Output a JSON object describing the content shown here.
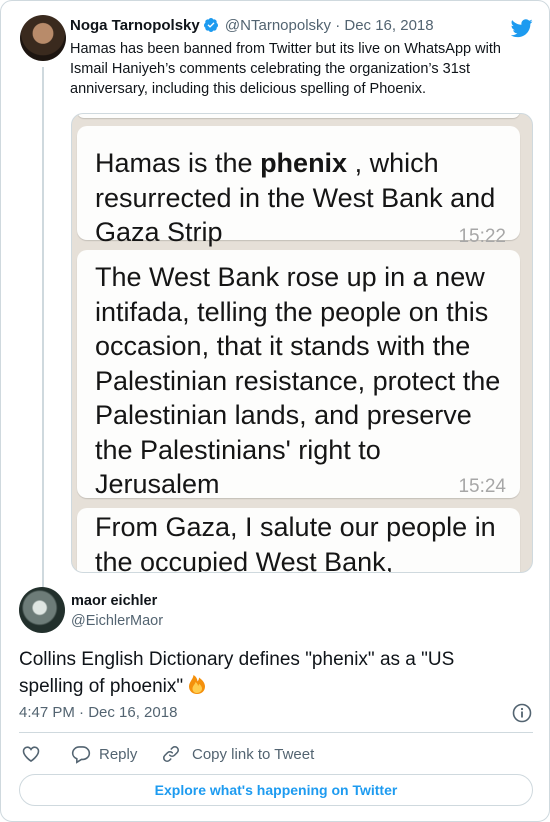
{
  "parent_tweet": {
    "name": "Noga Tarnopolsky",
    "handle": "@NTarnopolsky",
    "date": "Dec 16, 2018",
    "text": "Hamas has been banned from Twitter but its live on WhatsApp with Ismail Haniyeh’s comments celebrating the organization’s 31st anniversary, including this delicious spelling of Phoenix.",
    "media": {
      "bubbles": [
        {
          "before": "Hamas is the ",
          "bold": "phenix",
          "after": " , which resurrected in the West Bank and Gaza Strip",
          "time": "15:22"
        },
        {
          "text": "The West Bank rose up in a new intifada, telling the people on this occasion, that it stands with the Palestinian resistance, protect the Palestinian lands, and preserve the Palestinians' right to Jerusalem",
          "time": "15:24"
        },
        {
          "text": "From Gaza, I salute our people in the occupied West Bank, Jerusalem"
        }
      ]
    }
  },
  "reply_tweet": {
    "name": "maor eichler",
    "handle": "@EichlerMaor",
    "text": "Collins English Dictionary defines \"phenix\" as a \"US spelling of phoenix\"",
    "timestamp": "4:47 PM · Dec 16, 2018"
  },
  "actions": {
    "reply_label": "Reply",
    "copy_label": "Copy link to Tweet"
  },
  "explore_label": "Explore what's happening on Twitter",
  "colors": {
    "accent": "#1d9bf0",
    "secondary_text": "#536471",
    "border": "#cfd9de"
  },
  "icons": [
    "verified-badge-icon",
    "twitter-bird-icon",
    "fire-emoji-icon",
    "info-icon",
    "heart-icon",
    "reply-icon",
    "link-icon"
  ]
}
